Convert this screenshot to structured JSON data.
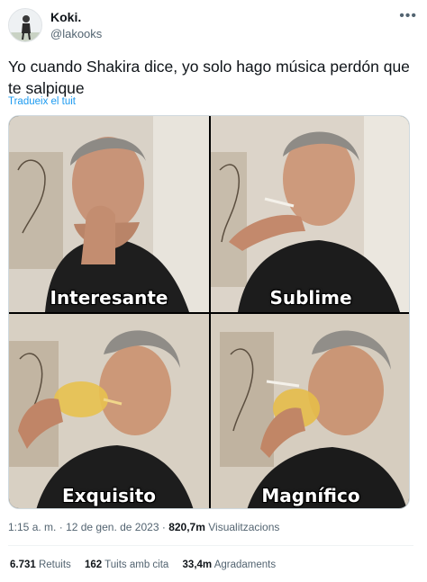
{
  "author": {
    "name": "Koki.",
    "handle": "@lakooks",
    "more_icon": "ellipsis-icon"
  },
  "tweet": {
    "text": "Yo cuando Shakira dice, yo solo hago música perdón que te salpique",
    "translate_label": "Tradueix el tuit"
  },
  "media": {
    "panels": [
      {
        "caption": "Interesante"
      },
      {
        "caption": "Sublime"
      },
      {
        "caption": "Exquisito"
      },
      {
        "caption": "Magnífico"
      }
    ]
  },
  "meta": {
    "time": "1:15 a. m.",
    "separator": "·",
    "date": "12 de gen. de 2023",
    "views_count": "820,7m",
    "views_label": "Visualitzacions"
  },
  "stats": {
    "retweets_count": "6.731",
    "retweets_label": "Retuits",
    "quotes_count": "162",
    "quotes_label": "Tuits amb cita",
    "likes_count": "33,4m",
    "likes_label": "Agradaments"
  }
}
